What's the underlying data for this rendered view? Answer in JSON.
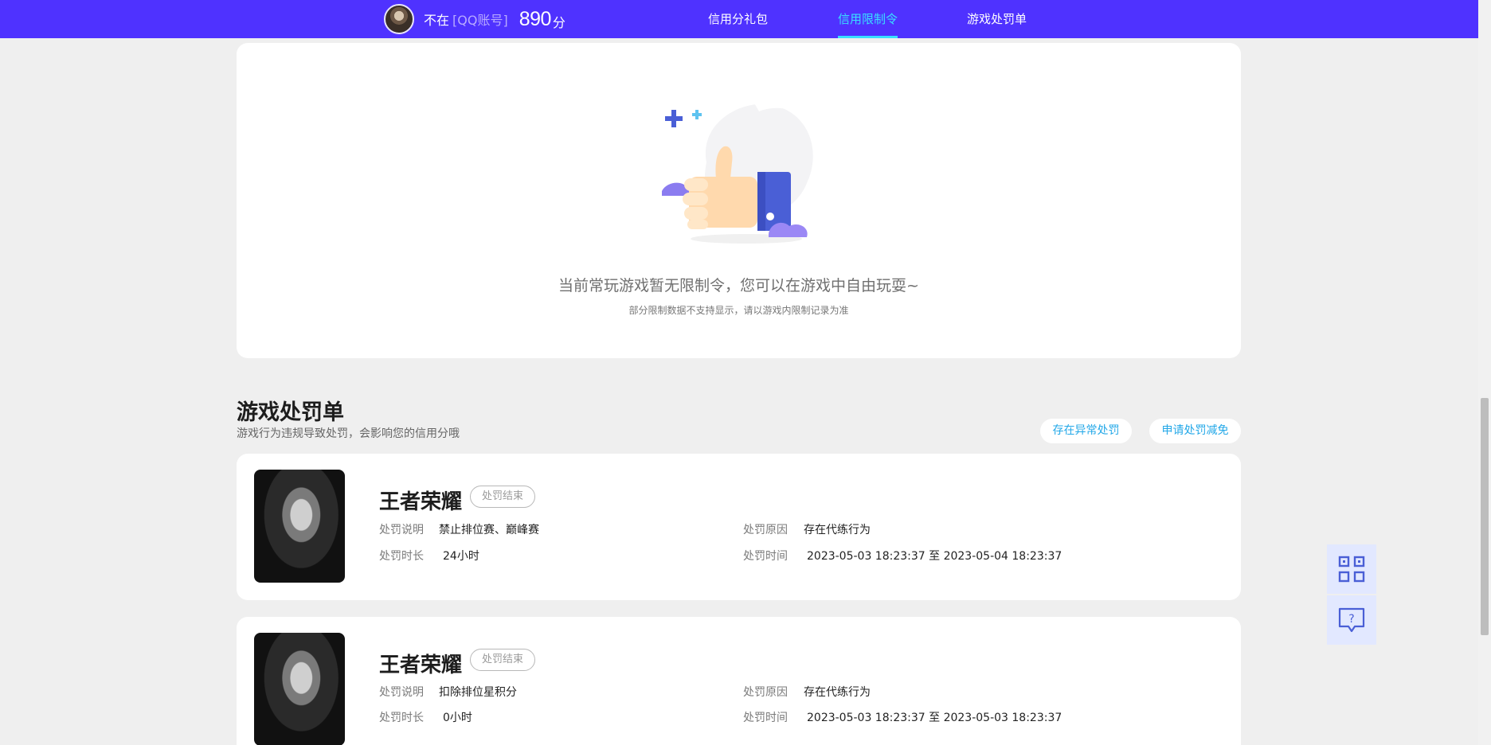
{
  "header": {
    "status": "不在",
    "account": "[QQ账号]",
    "score": "890",
    "score_unit": "分",
    "nav": [
      {
        "label": "信用分礼包",
        "active": false
      },
      {
        "label": "信用限制令",
        "active": true
      },
      {
        "label": "游戏处罚单",
        "active": false
      }
    ]
  },
  "restriction": {
    "empty_title": "当前常玩游戏暂无限制令，您可以在游戏中自由玩耍~",
    "empty_subtitle": "部分限制数据不支持显示，请以游戏内限制记录为准",
    "illustration_icon": "thumbs-up-illustration"
  },
  "penalty_section": {
    "title": "游戏处罚单",
    "subtitle": "游戏行为违规导致处罚，会影响您的信用分哦",
    "btn_abnormal": "存在异常处罚",
    "btn_reduce": "申请处罚减免"
  },
  "penalties": [
    {
      "game": "王者荣耀",
      "status": "处罚结束",
      "desc_label": "处罚说明",
      "desc": "禁止排位赛、巅峰赛",
      "reason_label": "处罚原因",
      "reason": "存在代练行为",
      "duration_label": "处罚时长",
      "duration": "24小时",
      "time_label": "处罚时间",
      "time": "2023-05-03 18:23:37 至 2023-05-04 18:23:37"
    },
    {
      "game": "王者荣耀",
      "status": "处罚结束",
      "desc_label": "处罚说明",
      "desc": "扣除排位星积分",
      "reason_label": "处罚原因",
      "reason": "存在代练行为",
      "duration_label": "处罚时长",
      "duration": "0小时",
      "time_label": "处罚时间",
      "time": "2023-05-03 18:23:37 至 2023-05-03 18:23:37"
    }
  ],
  "tools": {
    "qr_icon": "qr-code-icon",
    "help_icon": "question-chat-icon"
  },
  "colors": {
    "nav_bg": "#4f32ff",
    "nav_active": "#38e0ff",
    "link": "#23a8e8",
    "page_bg": "#efefef"
  }
}
